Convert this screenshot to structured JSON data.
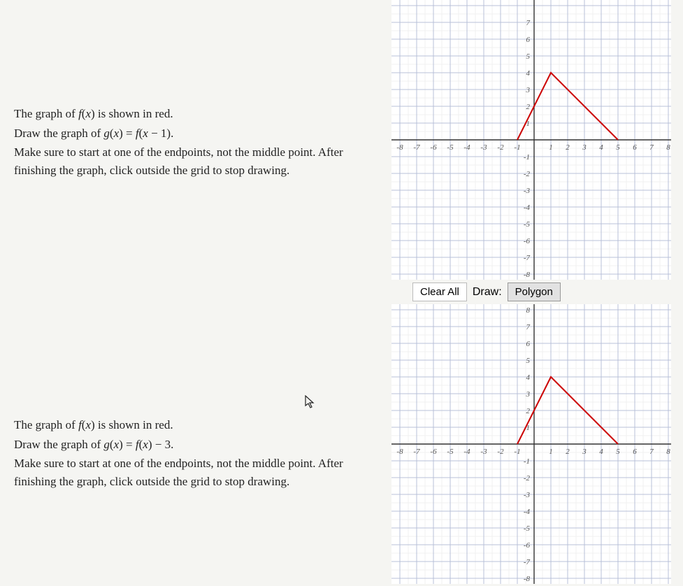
{
  "problems": [
    {
      "lines": [
        "The graph of f(x) is shown in red.",
        "Draw the graph of g(x) = f(x − 1).",
        "Make sure to start at one of the endpoints, not the middle point. After finishing the graph, click outside the grid to stop drawing."
      ]
    },
    {
      "lines": [
        "The graph of f(x) is shown in red.",
        "Draw the graph of g(x) = f(x) − 3.",
        "Make sure to start at one of the endpoints, not the middle point. After finishing the graph, click outside the grid to stop drawing."
      ]
    }
  ],
  "toolbar": {
    "clear_label": "Clear All",
    "draw_label": "Draw:",
    "tool_label": "Polygon"
  },
  "axis": {
    "xmin": -8,
    "xmax": 8,
    "ticks_x": [
      "-8",
      "-7",
      "-6",
      "-5",
      "-4",
      "-3",
      "-2",
      "-1",
      "1",
      "2",
      "3",
      "4",
      "5",
      "6",
      "7",
      "8"
    ],
    "ticks_y_top": [
      "7",
      "6",
      "5",
      "4",
      "3",
      "2",
      "1",
      "-1",
      "-2",
      "-3",
      "-4",
      "-5",
      "-6",
      "-7",
      "-8"
    ],
    "ticks_y_bottom": [
      "8",
      "7",
      "6",
      "5",
      "4",
      "3",
      "2",
      "1",
      "-1",
      "-2",
      "-3",
      "-4",
      "-5",
      "-6",
      "-7",
      "-8"
    ]
  },
  "chart_data": [
    {
      "type": "line",
      "title": "",
      "xlabel": "",
      "ylabel": "",
      "xlim": [
        -8,
        8
      ],
      "ylim": [
        -8,
        8
      ],
      "series": [
        {
          "name": "f(x)",
          "color": "#cc0000",
          "points": [
            [
              -1,
              0
            ],
            [
              1,
              4
            ],
            [
              5,
              0
            ]
          ]
        }
      ]
    },
    {
      "type": "line",
      "title": "",
      "xlabel": "",
      "ylabel": "",
      "xlim": [
        -8,
        8
      ],
      "ylim": [
        -8,
        8
      ],
      "series": [
        {
          "name": "f(x)",
          "color": "#cc0000",
          "points": [
            [
              -1,
              0
            ],
            [
              1,
              4
            ],
            [
              5,
              0
            ]
          ]
        }
      ]
    }
  ]
}
